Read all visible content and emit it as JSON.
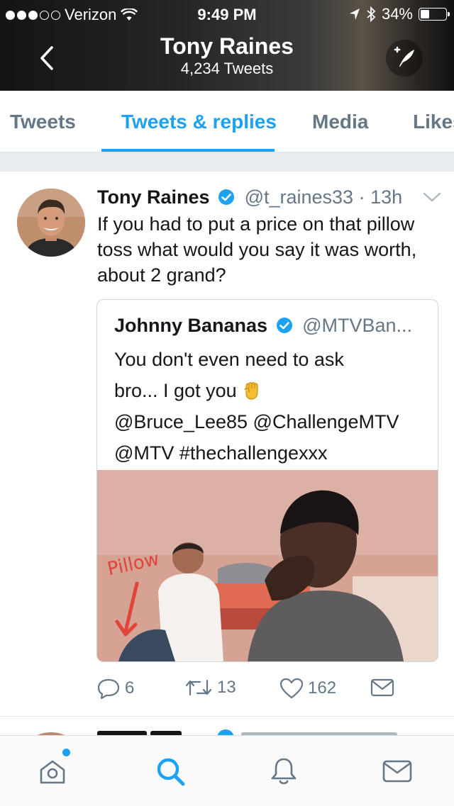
{
  "status_bar": {
    "carrier": "Verizon",
    "time": "9:49 PM",
    "battery": "34%",
    "battery_level": 0.34,
    "signal_bars": 3,
    "signal_total": 5
  },
  "header": {
    "profile_name": "Tony Raines",
    "tweet_count": "4,234 Tweets"
  },
  "tabs": [
    {
      "label": "Tweets",
      "active": false
    },
    {
      "label": "Tweets & replies",
      "active": true
    },
    {
      "label": "Media",
      "active": false
    },
    {
      "label": "Likes",
      "active": false
    }
  ],
  "tweet": {
    "author": "Tony Raines",
    "handle": "@t_raines33",
    "separator": "·",
    "time": "13h",
    "text": "If you had to put a price on that pillow toss what would you say it was worth, about 2 grand?",
    "quote": {
      "author": "Johnny Bananas",
      "handle": "@MTVBan...",
      "text_line1": "You don't even need to ask",
      "text_line2": "bro... I got you",
      "text_line3": "@Bruce_Lee85 @ChallengeMTV",
      "text_line4": "@MTV #thechallengexxx",
      "media_label": "Pillow"
    },
    "actions": {
      "reply_count": "6",
      "retweet_count": "13",
      "like_count": "162"
    }
  },
  "colors": {
    "accent": "#1da1f2",
    "text_primary": "#14171a",
    "text_secondary": "#657786",
    "divider": "#e1e8ed"
  },
  "icons": [
    "back-chevron-icon",
    "compose-tweet-icon",
    "verified-badge-icon",
    "caret-down-icon",
    "reply-icon",
    "retweet-icon",
    "like-heart-icon",
    "direct-message-icon",
    "home-icon",
    "search-icon",
    "notifications-bell-icon",
    "messages-envelope-icon"
  ]
}
